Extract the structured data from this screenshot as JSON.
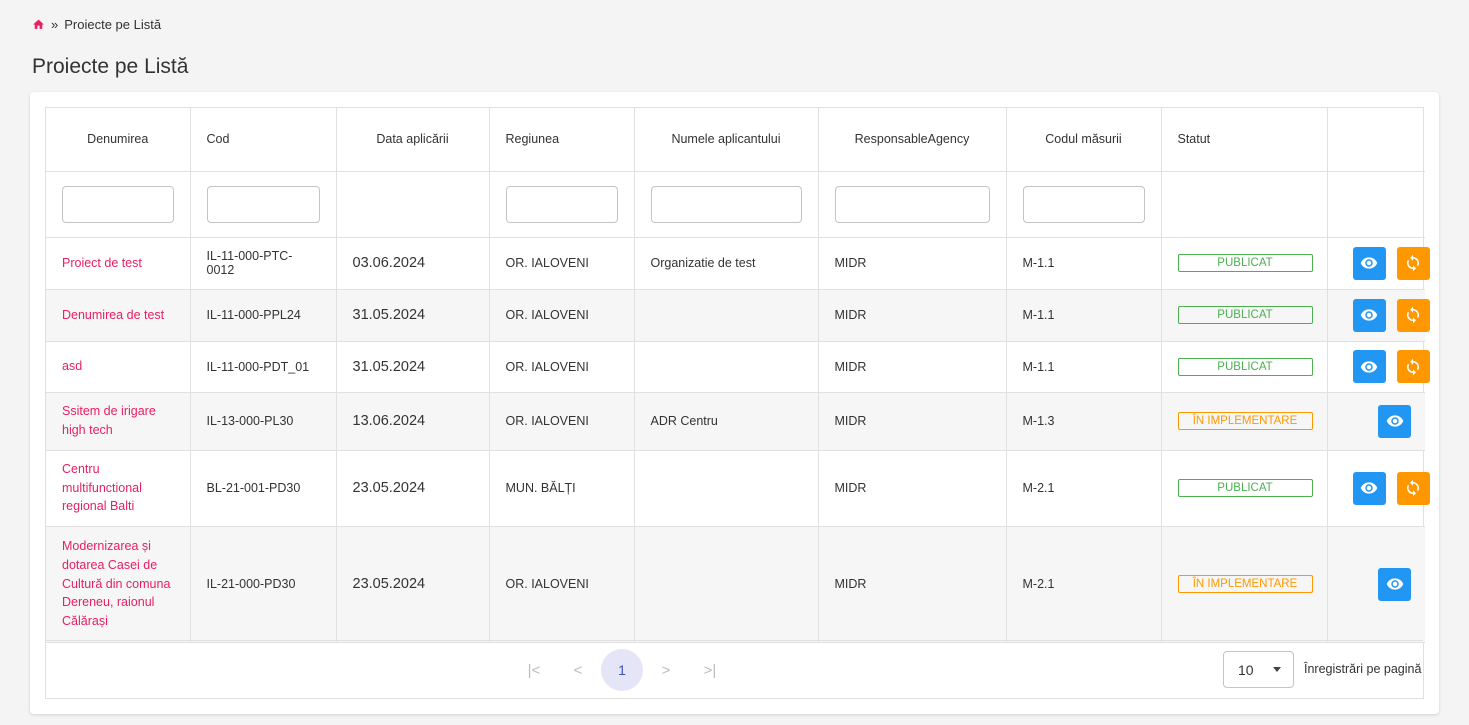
{
  "breadcrumb": {
    "separator": "»",
    "current": "Proiecte pe Listă"
  },
  "page": {
    "title": "Proiecte pe Listă"
  },
  "columns": [
    "Denumirea",
    "Cod",
    "Data aplicării",
    "Regiunea",
    "Numele aplicantului",
    "ResponsableAgency",
    "Codul măsurii",
    "Statut"
  ],
  "rows": [
    {
      "name": "Proiect de test",
      "code": "IL-11-000-PTC-0012",
      "date": "03.06.2024",
      "region": "OR. IALOVENI",
      "applicant": "Organizatie de test",
      "agency": "MIDR",
      "measure": "M-1.1",
      "status": "PUBLICAT"
    },
    {
      "name": "Denumirea de test",
      "code": "IL-11-000-PPL24",
      "date": "31.05.2024",
      "region": "OR. IALOVENI",
      "applicant": "",
      "agency": "MIDR",
      "measure": "M-1.1",
      "status": "PUBLICAT"
    },
    {
      "name": "asd",
      "code": "IL-11-000-PDT_01",
      "date": "31.05.2024",
      "region": "OR. IALOVENI",
      "applicant": "",
      "agency": "MIDR",
      "measure": "M-1.1",
      "status": "PUBLICAT"
    },
    {
      "name": "Ssitem de irigare high tech",
      "code": "IL-13-000-PL30",
      "date": "13.06.2024",
      "region": "OR. IALOVENI",
      "applicant": "ADR Centru",
      "agency": "MIDR",
      "measure": "M-1.3",
      "status": "ÎN IMPLEMENTARE"
    },
    {
      "name": "Centru multifunctional regional Balti",
      "code": "BL-21-001-PD30",
      "date": "23.05.2024",
      "region": "MUN. BĂLȚI",
      "applicant": "",
      "agency": "MIDR",
      "measure": "M-2.1",
      "status": "PUBLICAT"
    },
    {
      "name": "Modernizarea și dotarea Casei de Cultură din comuna Dereneu, raionul Călărași",
      "code": "IL-21-000-PD30",
      "date": "23.05.2024",
      "region": "OR. IALOVENI",
      "applicant": "",
      "agency": "MIDR",
      "measure": "M-2.1",
      "status": "ÎN IMPLEMENTARE"
    }
  ],
  "pagination": {
    "first": "|<",
    "prev": "<",
    "current_page": "1",
    "next": ">",
    "last": ">|",
    "page_size": "10",
    "page_size_label": "Înregistrări pe pagină"
  },
  "colors": {
    "link": "#e91e63",
    "published": "#4caf50",
    "in_progress": "#ff9800",
    "view_button": "#2196f3",
    "sync_button": "#ff9800",
    "current_page_bg": "#e5e5f8"
  }
}
